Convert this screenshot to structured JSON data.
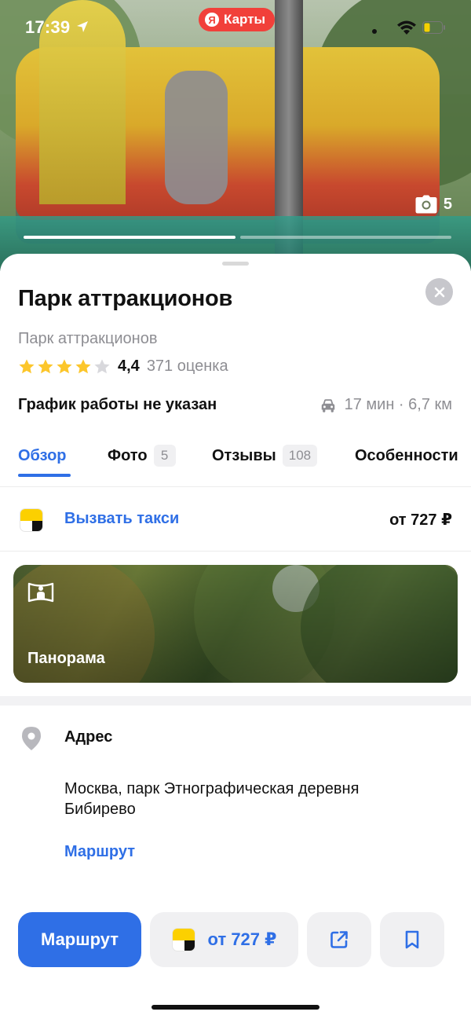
{
  "status_bar": {
    "time": "17:39"
  },
  "app_pill": {
    "logo": "Я",
    "label": "Карты"
  },
  "hero": {
    "photo_count": "5",
    "progress_segments": 2,
    "active_segment": 0
  },
  "place": {
    "title": "Парк аттракционов",
    "category": "Парк аттракционов",
    "rating_value": "4,4",
    "rating_count": "371 оценка",
    "stars_filled": 4,
    "hours": "График работы не указан",
    "travel": "17 мин · 6,7 км"
  },
  "tabs": [
    {
      "label": "Обзор",
      "badge": ""
    },
    {
      "label": "Фото",
      "badge": "5"
    },
    {
      "label": "Отзывы",
      "badge": "108"
    },
    {
      "label": "Особенности",
      "badge": ""
    }
  ],
  "taxi": {
    "label": "Вызвать такси",
    "price": "от 727 ₽"
  },
  "panorama": {
    "label": "Панорама"
  },
  "address": {
    "title": "Адрес",
    "text": "Москва, парк Этнографическая деревня Бибирево",
    "route_link": "Маршрут"
  },
  "bottom_bar": {
    "route_button": "Маршрут",
    "taxi_button": "от 727 ₽"
  },
  "colors": {
    "accent": "#2f6fe6",
    "brand_red": "#f1403a",
    "star": "#fcc62b",
    "taxi_yellow": "#fcd000"
  }
}
